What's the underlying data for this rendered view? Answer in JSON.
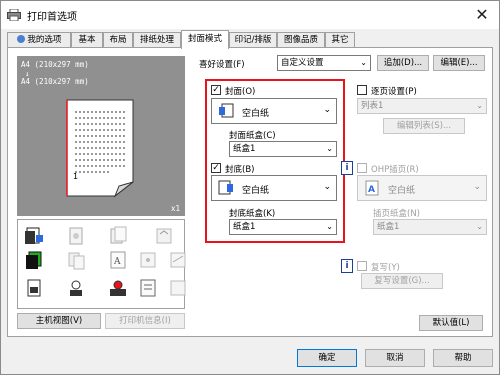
{
  "window": {
    "title": "打印首选项",
    "close_label": "✕"
  },
  "tabs": [
    {
      "label": "我的选项"
    },
    {
      "label": "基本"
    },
    {
      "label": "布局"
    },
    {
      "label": "排纸处理"
    },
    {
      "label": "封面模式",
      "active": true
    },
    {
      "label": "印记/排版"
    },
    {
      "label": "图像品质"
    },
    {
      "label": "其它"
    }
  ],
  "preview": {
    "line1": "A4 (210x297 mm)",
    "arrow": "↓",
    "line2": "A4 (210x297 mm)",
    "page_label": "1",
    "scale_label": "x1"
  },
  "left_buttons": {
    "printer_view": "主机视图(V)",
    "printer_info": "打印机信息(I)"
  },
  "favorites": {
    "label": "喜好设置(F)",
    "value": "自定义设置",
    "add_button": "追加(D)...",
    "edit_button": "编辑(E)..."
  },
  "front_cover": {
    "label": "封面(O)",
    "checked": true,
    "paper": "空白纸",
    "tray_label": "封面纸盒(C)",
    "tray_value": "纸盒1"
  },
  "back_cover": {
    "label": "封底(B)",
    "checked": true,
    "paper": "空白纸",
    "tray_label": "封底纸盒(K)",
    "tray_value": "纸盒1"
  },
  "page_settings": {
    "label": "逐页设置(P)",
    "list_value": "列表1",
    "edit_list": "编辑列表(S)..."
  },
  "ohp": {
    "label": "OHP插页(R)",
    "paper": "空白纸",
    "tray_label": "插页纸盒(N)",
    "tray_value": "纸盒1"
  },
  "copy": {
    "label": "复写(Y)",
    "settings_button": "复写设置(G)..."
  },
  "default_button": "默认值(L)",
  "footer": {
    "ok": "确定",
    "cancel": "取消",
    "help": "帮助"
  }
}
